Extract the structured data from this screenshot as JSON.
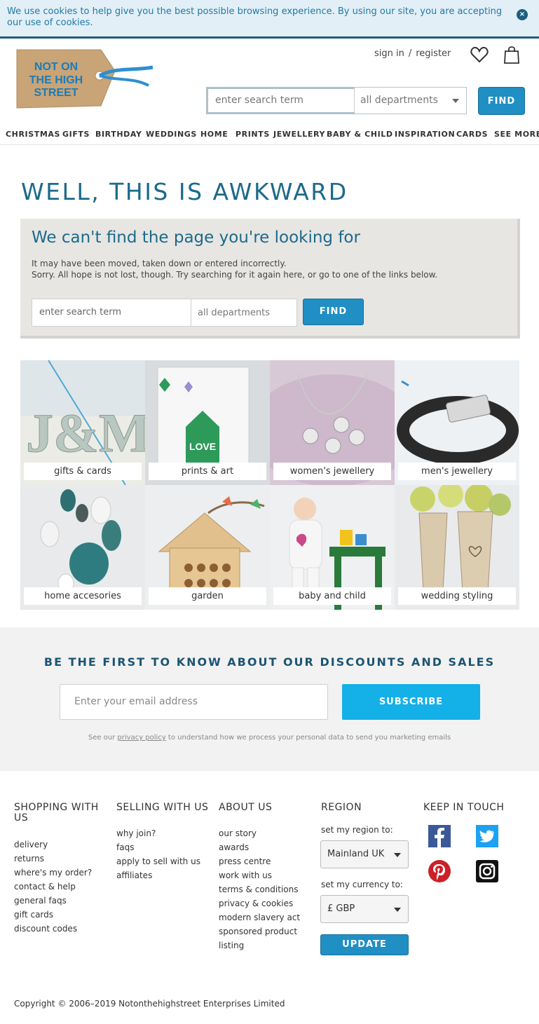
{
  "cookie": {
    "text": "We use cookies to help give you the best possible browsing experience. By using our site, you are accepting our use of cookies.",
    "close": "×"
  },
  "header": {
    "logo_lines": [
      "NOT ON",
      "THE HIGH",
      "STREET"
    ],
    "sign_in": "sign in",
    "separator": "/",
    "register": "register",
    "search_placeholder": "enter search term",
    "department": "all departments",
    "find": "FIND"
  },
  "nav": [
    "CHRISTMAS",
    "GIFTS",
    "BIRTHDAY",
    "WEDDINGS",
    "HOME",
    "PRINTS",
    "JEWELLERY",
    "BABY & CHILD",
    "INSPIRATION",
    "CARDS",
    "SEE MORE"
  ],
  "error": {
    "heading": "WELL, THIS IS AWKWARD",
    "subheading": "We can't find the page you're looking for",
    "line1": "It may have been moved, taken down or entered incorrectly.",
    "line2": "Sorry. All hope is not lost, though. Try searching for it again here, or go to one of the links below.",
    "search_placeholder": "enter search term",
    "department": "all departments",
    "find": "FIND"
  },
  "tiles": [
    {
      "label": "gifts & cards"
    },
    {
      "label": "prints & art"
    },
    {
      "label": "women's jewellery"
    },
    {
      "label": "men's jewellery"
    },
    {
      "label": "home accesories"
    },
    {
      "label": "garden"
    },
    {
      "label": "baby and child"
    },
    {
      "label": "wedding styling"
    }
  ],
  "tile_text": {
    "letters": "J&M",
    "print_word": "LOVE"
  },
  "newsletter": {
    "heading": "BE THE FIRST TO KNOW ABOUT OUR DISCOUNTS AND SALES",
    "email_placeholder": "Enter your email address",
    "subscribe": "SUBSCRIBE",
    "note_before": "See our ",
    "note_link": "privacy policy",
    "note_after": " to understand how we process your personal data to send you marketing emails"
  },
  "footer": {
    "shopping": {
      "heading_line1": "SHOPPING WITH",
      "heading_line2": "US",
      "links": [
        "delivery",
        "returns",
        "where's my order?",
        "contact & help",
        "general faqs",
        "gift cards",
        "discount codes"
      ]
    },
    "selling": {
      "heading": "SELLING WITH US",
      "links": [
        "why join?",
        "faqs",
        "apply to sell with us",
        "affiliates"
      ]
    },
    "about": {
      "heading": "ABOUT US",
      "links": [
        "our story",
        "awards",
        "press centre",
        "work with us",
        "terms & conditions",
        "privacy & cookies",
        "modern slavery act",
        "sponsored product",
        "listing"
      ]
    },
    "region": {
      "heading": "REGION",
      "region_label": "set my region to:",
      "region_value": "Mainland UK",
      "currency_label": "set my currency to:",
      "currency_value": "£ GBP",
      "update": "UPDATE"
    },
    "keep_in_touch": {
      "heading": "KEEP IN TOUCH",
      "icons": [
        "facebook-icon",
        "twitter-icon",
        "pinterest-icon",
        "instagram-icon"
      ]
    },
    "copyright": "Copyright © 2006–2019 Notonthehighstreet Enterprises Limited"
  },
  "colors": {
    "brand_blue": "#1b6a8a",
    "button_blue": "#1f8fc4",
    "subscribe_blue": "#14b0e8"
  }
}
